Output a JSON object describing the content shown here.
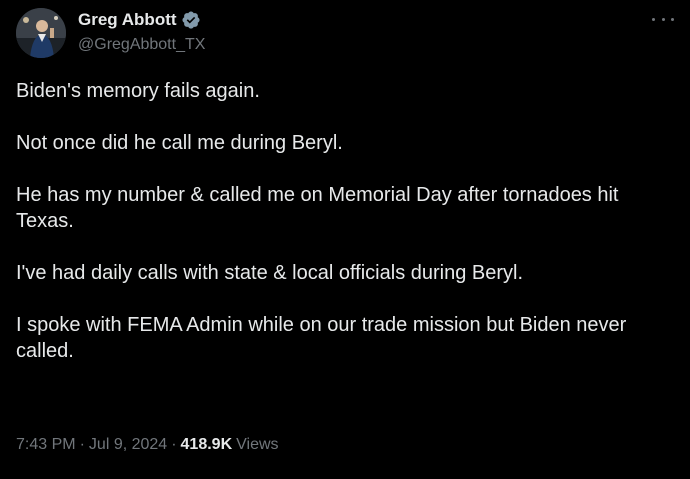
{
  "author": {
    "display_name": "Greg Abbott",
    "handle": "@GregAbbott_TX",
    "verified_icon": "verified-badge-icon",
    "verified_color": "#829aab"
  },
  "menu": {
    "more_icon": "more-horizontal-icon"
  },
  "post": {
    "paragraphs": [
      "Biden's memory fails again.",
      "Not once did he call me during Beryl.",
      "He has my number & called me on Memorial Day after tornadoes hit Texas.",
      "I've had daily calls with state & local officials during Beryl.",
      "I spoke with FEMA Admin while on our trade mission but Biden never called."
    ]
  },
  "meta": {
    "time": "7:43 PM",
    "separator": "·",
    "date": "Jul 9, 2024",
    "views_count": "418.9K",
    "views_label": "Views"
  },
  "colors": {
    "background": "#000000",
    "text_primary": "#e7e9ea",
    "text_secondary": "#71767b"
  }
}
